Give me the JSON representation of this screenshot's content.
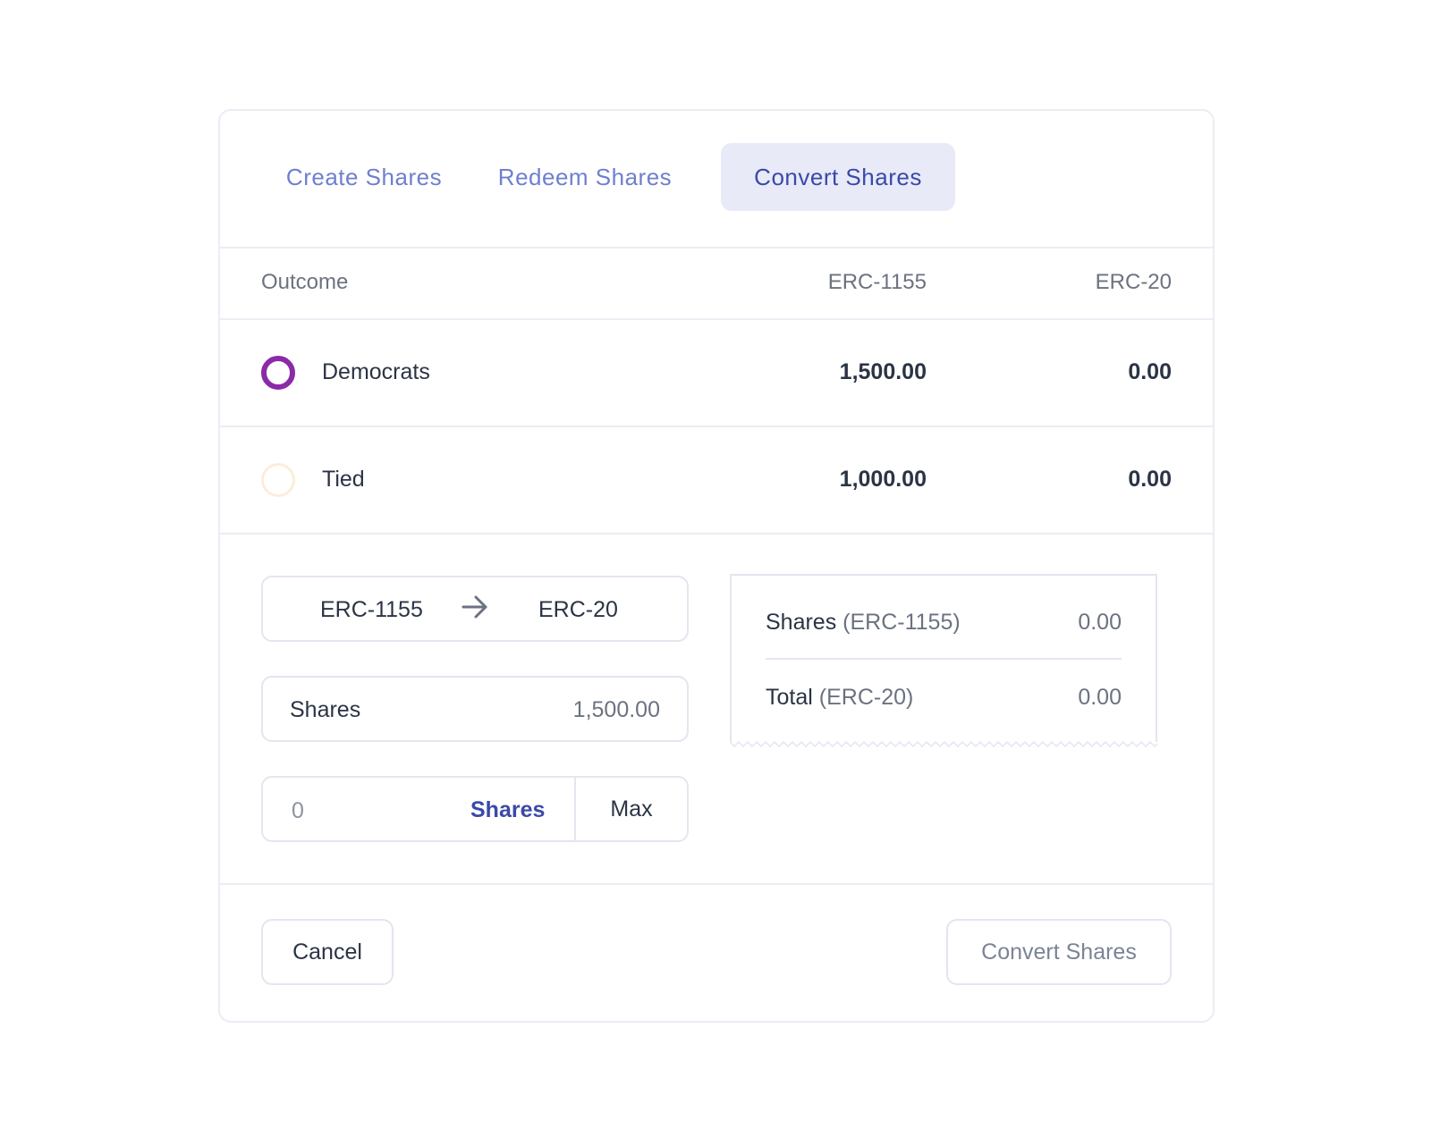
{
  "tabs": [
    {
      "label": "Create Shares"
    },
    {
      "label": "Redeem Shares"
    },
    {
      "label": "Convert Shares"
    }
  ],
  "table": {
    "headers": {
      "outcome": "Outcome",
      "erc1155": "ERC-1155",
      "erc20": "ERC-20"
    },
    "rows": [
      {
        "label": "Democrats",
        "erc1155": "1,500.00",
        "erc20": "0.00",
        "selected": true
      },
      {
        "label": "Tied",
        "erc1155": "1,000.00",
        "erc20": "0.00",
        "selected": false
      }
    ]
  },
  "direction": {
    "from": "ERC-1155",
    "to": "ERC-20",
    "icon": "arrow-right-icon"
  },
  "balance": {
    "label": "Shares",
    "value": "1,500.00"
  },
  "amount": {
    "placeholder": "0",
    "unit": "Shares",
    "max_label": "Max"
  },
  "summary": {
    "shares_label": "Shares",
    "shares_unit": "(ERC-1155)",
    "shares_value": "0.00",
    "total_label": "Total",
    "total_unit": "(ERC-20)",
    "total_value": "0.00"
  },
  "footer": {
    "cancel_label": "Cancel",
    "convert_label": "Convert Shares"
  },
  "colors": {
    "accent": "#3a49a8",
    "tab_inactive": "#6f7fcf",
    "tab_active_bg": "#e8eaf7",
    "radio_selected": "#8b2aa8",
    "radio_unselected": "#fbeed9"
  }
}
